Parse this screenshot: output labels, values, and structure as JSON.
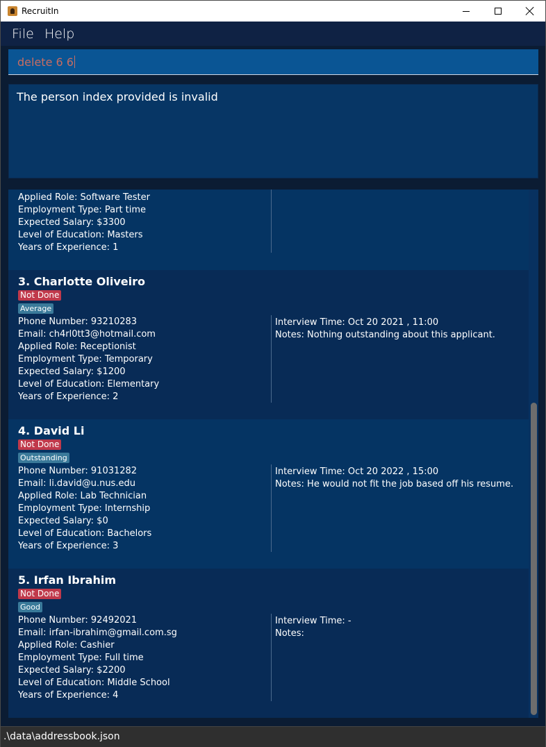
{
  "window": {
    "title": "RecruitIn"
  },
  "menu": {
    "file": "File",
    "help": "Help"
  },
  "command": {
    "value": "delete 6 6"
  },
  "result": {
    "message": "The person index provided is invalid"
  },
  "partial_card": {
    "applied_role": "Applied Role: Software Tester",
    "employment_type": "Employment Type: Part time",
    "expected_salary": "Expected Salary: $3300",
    "education": "Level of Education: Masters",
    "experience": "Years of Experience: 1"
  },
  "applicants": [
    {
      "name": "3.  Charlotte Oliveiro",
      "status": "Not Done",
      "rating": "Average",
      "phone": "Phone Number: 93210283",
      "email": "Email: ch4rl0tt3@hotmail.com",
      "applied_role": "Applied Role: Receptionist",
      "employment_type": "Employment Type: Temporary",
      "expected_salary": "Expected Salary: $1200",
      "education": "Level of Education: Elementary",
      "experience": "Years of Experience: 2",
      "interview_time": "Interview Time: Oct 20 2021 , 11:00",
      "notes": "Notes: Nothing outstanding about this applicant."
    },
    {
      "name": "4.  David Li",
      "status": "Not Done",
      "rating": "Outstanding",
      "phone": "Phone Number: 91031282",
      "email": "Email: li.david@u.nus.edu",
      "applied_role": "Applied Role: Lab Technician",
      "employment_type": "Employment Type: Internship",
      "expected_salary": "Expected Salary: $0",
      "education": "Level of Education: Bachelors",
      "experience": "Years of Experience: 3",
      "interview_time": "Interview Time: Oct 20 2022 , 15:00",
      "notes": "Notes: He would not fit the job based off his resume."
    },
    {
      "name": "5.  Irfan Ibrahim",
      "status": "Not Done",
      "rating": "Good",
      "phone": "Phone Number: 92492021",
      "email": "Email: irfan-ibrahim@gmail.com.sg",
      "applied_role": "Applied Role: Cashier",
      "employment_type": "Employment Type: Full time",
      "expected_salary": "Expected Salary: $2200",
      "education": "Level of Education: Middle School",
      "experience": "Years of Experience: 4",
      "interview_time": "Interview Time: -",
      "notes": "Notes:"
    }
  ],
  "status_bar": {
    "path": ".\\data\\addressbook.json"
  },
  "colors": {
    "background": "#0b1c33",
    "card_odd": "#053463",
    "card_even": "#082b56",
    "status_badge": "#c0394b",
    "rating_badge": "#3a7a9a",
    "command_box": "#0a5594",
    "command_text": "#c86d62"
  }
}
